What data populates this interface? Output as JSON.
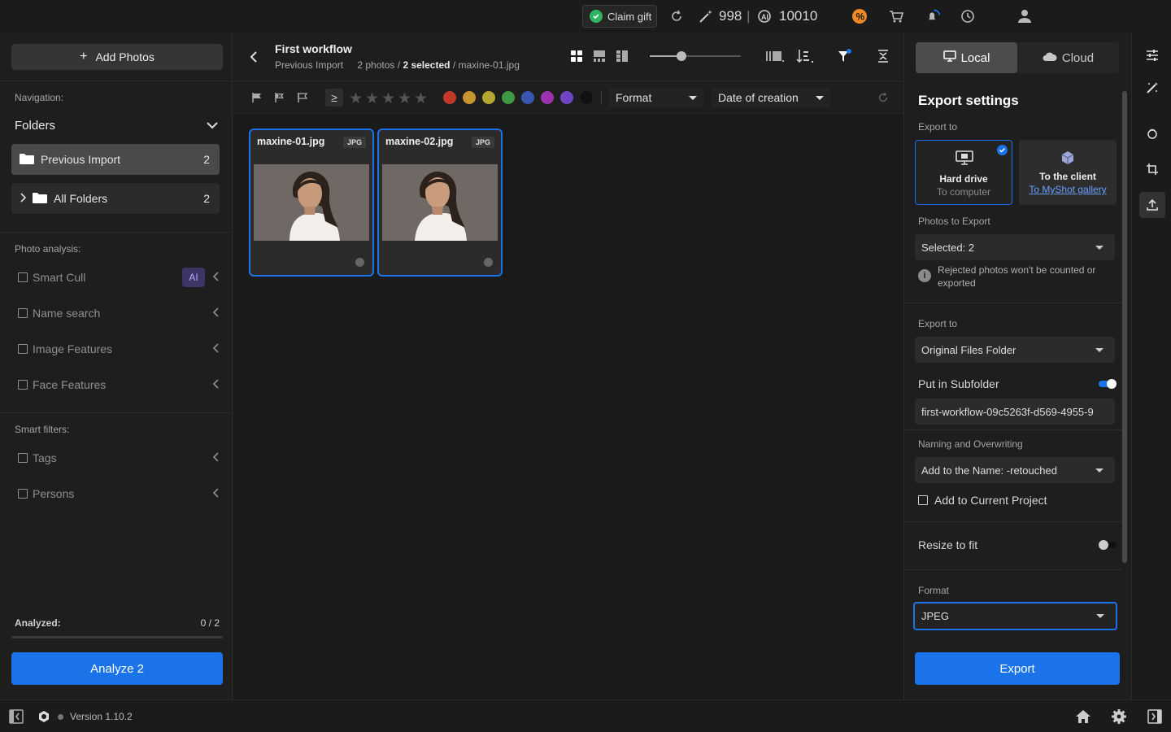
{
  "topbar": {
    "claim_gift": "Claim gift",
    "credits": "998",
    "separator": "|",
    "ai_credits": "10010"
  },
  "left": {
    "add_photos": "Add Photos",
    "navigation_label": "Navigation:",
    "folders_label": "Folders",
    "folders": [
      {
        "name": "Previous Import",
        "count": "2"
      },
      {
        "name": "All Folders",
        "count": "2"
      }
    ],
    "photo_analysis_label": "Photo analysis:",
    "analysis": [
      {
        "label": "Smart Cull",
        "badge": "AI"
      },
      {
        "label": "Name search"
      },
      {
        "label": "Image Features"
      },
      {
        "label": "Face Features"
      }
    ],
    "smart_filters_label": "Smart filters:",
    "smart_filters": [
      {
        "label": "Tags"
      },
      {
        "label": "Persons"
      }
    ],
    "analyzed_label": "Analyzed:",
    "analyzed_value": "0 / 2",
    "analyzed_fraction": 0,
    "analyze_button": "Analyze 2"
  },
  "center": {
    "title": "First workflow",
    "breadcrumb": "Previous Import",
    "photos_count": "2 photos /",
    "selected": "2 selected",
    "current_file": "/ maxine-01.jpg",
    "ge_symbol": "≥",
    "format_dropdown": "Format",
    "date_dropdown": "Date of creation",
    "color_labels": [
      "#c0392b",
      "#c9952e",
      "#b5a632",
      "#3f9a46",
      "#3a55b0",
      "#9b33b0",
      "#6e45c4",
      "#111111"
    ],
    "thumbnails": [
      {
        "file": "maxine-01.jpg",
        "type": "JPG"
      },
      {
        "file": "maxine-02.jpg",
        "type": "JPG"
      }
    ]
  },
  "right": {
    "local": "Local",
    "cloud": "Cloud",
    "title": "Export settings",
    "export_to_label": "Export to",
    "hard_drive": "Hard drive",
    "to_computer": "To computer",
    "to_client": "To the client",
    "to_gallery": "To MyShot gallery",
    "photos_to_export_label": "Photos to Export",
    "photos_to_export_value": "Selected: 2",
    "rejected_note": "Rejected photos won't be counted or exported",
    "export_to_label2": "Export to",
    "export_folder_value": "Original Files Folder",
    "subfolder_label": "Put in Subfolder",
    "subfolder_on": true,
    "subfolder_name": "first-workflow-09c5263f-d569-4955-9",
    "naming_label": "Naming and Overwriting",
    "naming_value": "Add to the Name: -retouched",
    "add_to_project": "Add to Current Project",
    "resize_label": "Resize to fit",
    "resize_on": false,
    "format_label": "Format",
    "format_value": "JPEG",
    "export_button": "Export",
    "accent": "#1a73e8"
  },
  "bottombar": {
    "version": "Version 1.10.2"
  }
}
